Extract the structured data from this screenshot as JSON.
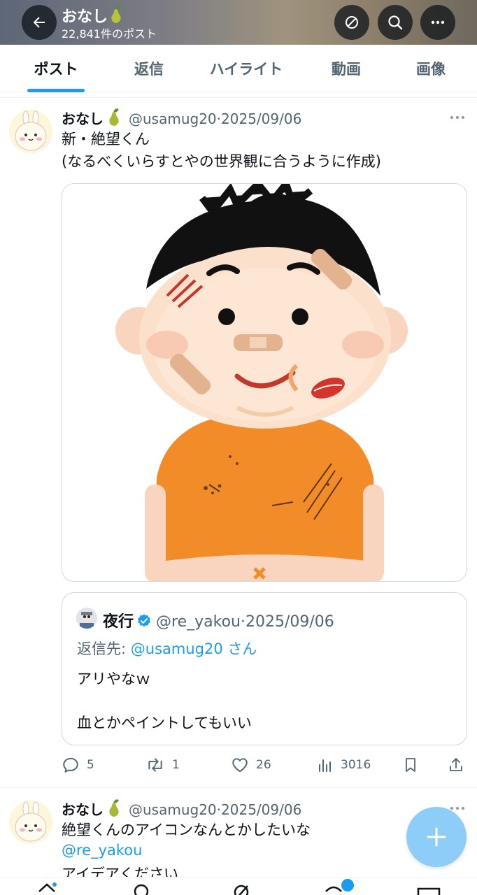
{
  "header": {
    "title": "おなし",
    "post_count": "22,841件のポスト",
    "icons": [
      "back-arrow-icon",
      "translate-icon",
      "search-icon",
      "more-icon"
    ]
  },
  "tabs": [
    {
      "label": "ポスト",
      "active": true
    },
    {
      "label": "返信",
      "active": false
    },
    {
      "label": "ハイライト",
      "active": false
    },
    {
      "label": "動画",
      "active": false
    },
    {
      "label": "画像",
      "active": false
    }
  ],
  "post1": {
    "name": "おなし",
    "handle": "@usamug20",
    "date": "2025/09/06",
    "line1": "新・絶望くん",
    "line2": "(なるべくいらすとやの世界観に合うように作成)",
    "quote": {
      "name": "夜行",
      "handle": "@re_yakou",
      "date": "2025/09/06",
      "reply_prefix": "返信先: ",
      "reply_mention": "@usamug20 さん",
      "line1": "アリやなｗ",
      "line2": "血とかペイントしてもいい"
    },
    "actions": {
      "replies": "5",
      "reposts": "1",
      "likes": "26",
      "views": "3016"
    }
  },
  "post2": {
    "name": "おなし",
    "handle": "@usamug20",
    "date": "2025/09/06",
    "line1": "絶望くんのアイコンなんとかしたいな",
    "mention": "@re_yakou",
    "line3": "アイデアください"
  },
  "sep": "·",
  "colors": {
    "accent": "#1d9bf0",
    "text": "#0f1419",
    "muted": "#536471",
    "fab": "#8ecdf8"
  }
}
